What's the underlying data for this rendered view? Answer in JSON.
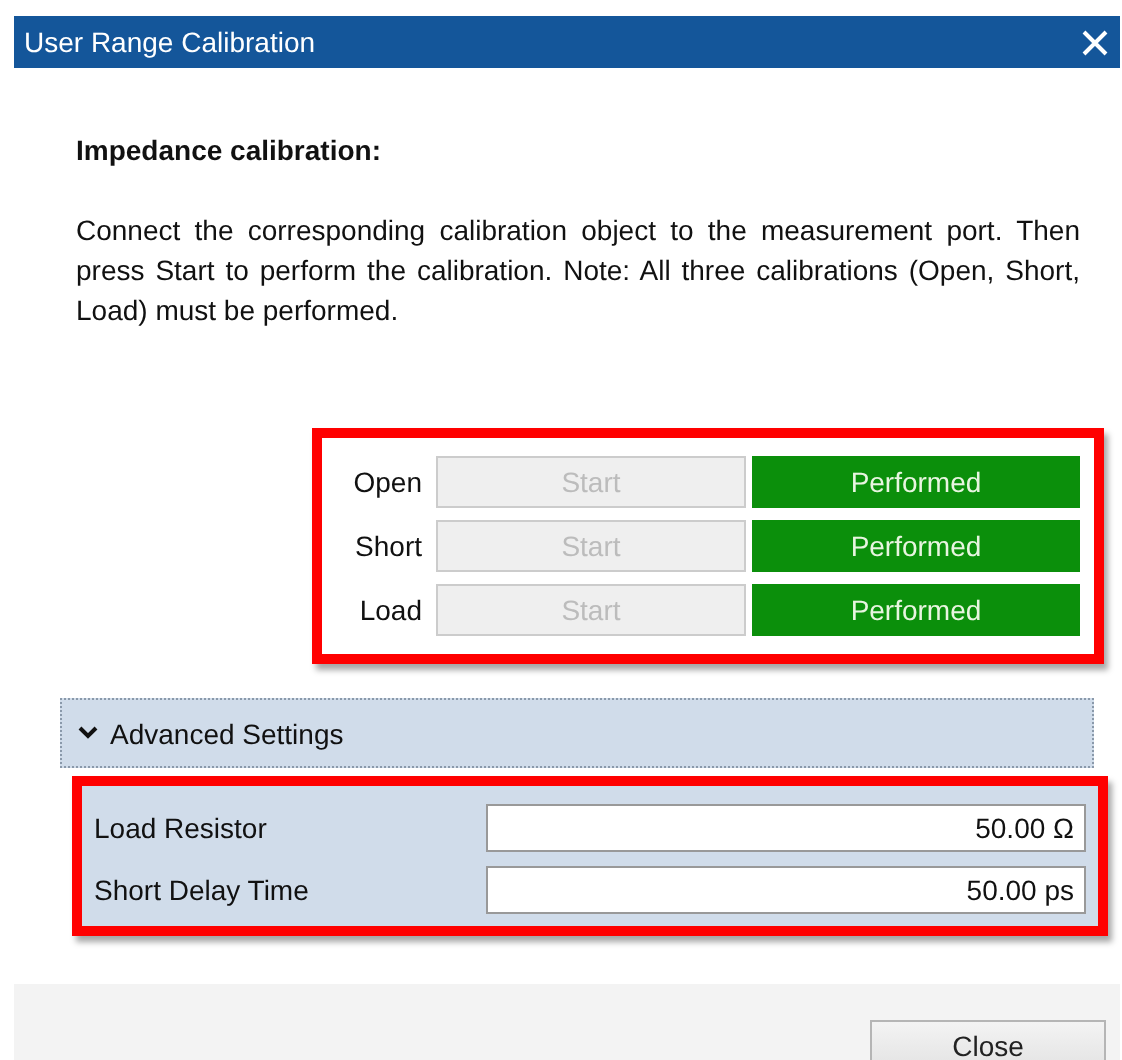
{
  "window": {
    "title": "User Range Calibration"
  },
  "heading": "Impedance calibration:",
  "instructions": "Connect the corresponding calibration object to the measurement port. Then press Start to perform the calibration. Note: All three calibrations (Open, Short, Load) must be performed.",
  "calibration": {
    "highlighted": true,
    "rows": [
      {
        "label": "Open",
        "button": "Start",
        "disabled": true,
        "status": "Performed",
        "performed": true
      },
      {
        "label": "Short",
        "button": "Start",
        "disabled": true,
        "status": "Performed",
        "performed": true
      },
      {
        "label": "Load",
        "button": "Start",
        "disabled": true,
        "status": "Performed",
        "performed": true
      }
    ]
  },
  "advanced": {
    "label": "Advanced Settings",
    "expanded": true,
    "highlighted": true,
    "fields": [
      {
        "label": "Load Resistor",
        "value": "50.00 Ω"
      },
      {
        "label": "Short Delay Time",
        "value": "50.00 ps"
      }
    ]
  },
  "buttons": [
    "Close"
  ]
}
